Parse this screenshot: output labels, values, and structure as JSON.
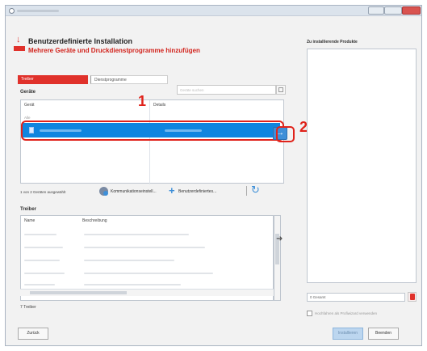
{
  "header": {
    "title": "Benutzerdefinierte Installation",
    "subtitle": "Mehrere Geräte und Druckdienstprogramme hinzufügen"
  },
  "tabs": [
    {
      "label": "Treiber"
    },
    {
      "label": "Dienstprogramme"
    }
  ],
  "devices": {
    "section_title": "Geräte",
    "search_placeholder": "Geräte suchen",
    "columns": [
      "Gerät",
      "Details"
    ],
    "sub_label": "Alle"
  },
  "toolbar": {
    "selection_count": "1 von 2 Geräten ausgewählt",
    "communication_label": "Kommunikationseinstell...",
    "custom_label": "Benutzerdefiniertes..."
  },
  "drivers": {
    "section_title": "Treiber",
    "columns": [
      "Name",
      "Beschreibung"
    ],
    "count": "7 Treiber"
  },
  "right_panel": {
    "title": "Zu installierende Produkte",
    "total": "0 Gesamt",
    "checkbox_label": "Hochfahren als Profiwizard verwenden"
  },
  "steps": {
    "step1": "1",
    "step2": "2"
  },
  "buttons": {
    "back": "Zurück",
    "install": "Installieren",
    "finish": "Beenden"
  },
  "colors": {
    "brand_red": "#e0312b",
    "selection_blue": "#0f85df",
    "accent_blue": "#3e8fd8"
  }
}
